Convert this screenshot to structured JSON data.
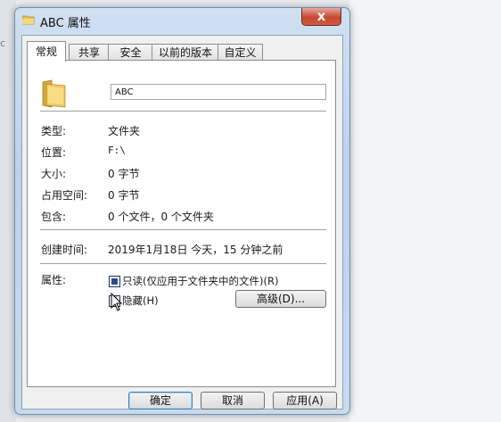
{
  "window": {
    "title": "ABC 属性",
    "close_glyph": "x"
  },
  "tabs": [
    {
      "label": "常规",
      "active": true
    },
    {
      "label": "共享",
      "active": false
    },
    {
      "label": "安全",
      "active": false
    },
    {
      "label": "以前的版本",
      "active": false
    },
    {
      "label": "自定义",
      "active": false
    }
  ],
  "general": {
    "folder_name": "ABC",
    "type_label": "类型:",
    "type_value": "文件夹",
    "location_label": "位置:",
    "location_value": "F:\\",
    "size_label": "大小:",
    "size_value": "0 字节",
    "size_on_disk_label": "占用空间:",
    "size_on_disk_value": "0 字节",
    "contains_label": "包含:",
    "contains_value": "0 个文件，0 个文件夹",
    "created_label": "创建时间:",
    "created_value": "2019年1月18日 今天，15 分钟之前",
    "attributes_label": "属性:",
    "readonly_label": "只读(仅应用于文件夹中的文件)(R)",
    "readonly_state": "indeterminate",
    "hidden_label": "隐藏(H)",
    "hidden_checked": true,
    "advanced_label": "高级(D)..."
  },
  "buttons": {
    "ok": "确定",
    "cancel": "取消",
    "apply": "应用(A)"
  },
  "icons": {
    "title": "folder-icon",
    "folder": "folder-icon",
    "cursor": "mouse-pointer-icon"
  },
  "colors": {
    "title_bg": "#c7daee",
    "close_button": "#c8472f",
    "checkbox_fill": "#2c4d8c"
  }
}
